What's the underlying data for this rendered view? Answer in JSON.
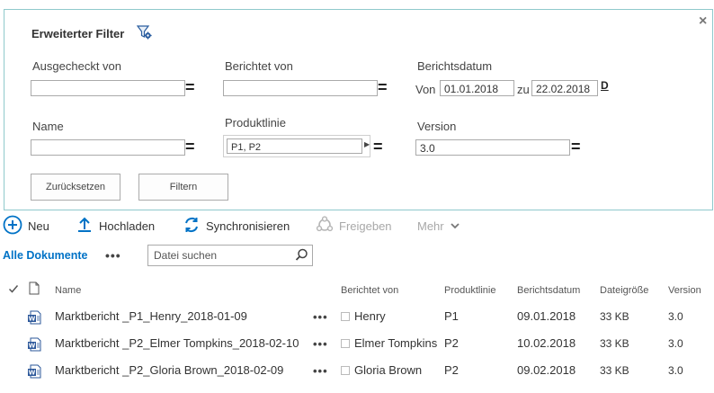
{
  "filter": {
    "title": "Erweiterter Filter",
    "close_label": "×",
    "fields": {
      "ausgecheckt": {
        "label": "Ausgecheckt von",
        "value": ""
      },
      "berichtet": {
        "label": "Berichtet von",
        "value": ""
      },
      "berichtsdatum": {
        "label": "Berichtsdatum",
        "von_label": "Von",
        "von_value": "01.01.2018",
        "zu_label": "zu",
        "zu_value": "22.02.2018",
        "picker_label": "D"
      },
      "name": {
        "label": "Name",
        "value": ""
      },
      "produktlinie": {
        "label": "Produktlinie",
        "value": "P1, P2"
      },
      "version": {
        "label": "Version",
        "value": "3.0"
      }
    },
    "equals": "=",
    "reset_label": "Zurücksetzen",
    "filter_label": "Filtern"
  },
  "toolbar": {
    "neu": "Neu",
    "hochladen": "Hochladen",
    "synchronisieren": "Synchronisieren",
    "freigeben": "Freigeben",
    "mehr": "Mehr"
  },
  "view": {
    "label": "Alle Dokumente",
    "more": "•••",
    "search_placeholder": "Datei suchen"
  },
  "table": {
    "headers": [
      "Name",
      "Berichtet von",
      "Produktlinie",
      "Berichtsdatum",
      "Dateigröße",
      "Version"
    ],
    "rows": [
      {
        "name": "Marktbericht _P1_Henry_2018-01-09",
        "berichtet": "Henry",
        "produkt": "P1",
        "datum": "09.01.2018",
        "groesse": "33 KB",
        "version": "3.0"
      },
      {
        "name": "Marktbericht _P2_Elmer Tompkins_2018-02-10",
        "berichtet": "Elmer Tompkins",
        "produkt": "P2",
        "datum": "10.02.2018",
        "groesse": "33 KB",
        "version": "3.0"
      },
      {
        "name": "Marktbericht _P2_Gloria Brown_2018-02-09",
        "berichtet": "Gloria Brown",
        "produkt": "P2",
        "datum": "09.02.2018",
        "groesse": "33 KB",
        "version": "3.0"
      }
    ],
    "row_more": "•••"
  },
  "colors": {
    "accent": "#0072c6",
    "panel_border": "#8fc9cc",
    "word_blue": "#2b579a"
  },
  "icons": {
    "filter": "filter-gear-icon",
    "neu": "plus-circle-icon",
    "hochladen": "upload-arrow-icon",
    "sync": "sync-icon",
    "freigeben": "share-icon",
    "search": "search-icon",
    "doc": "word-doc-icon"
  }
}
